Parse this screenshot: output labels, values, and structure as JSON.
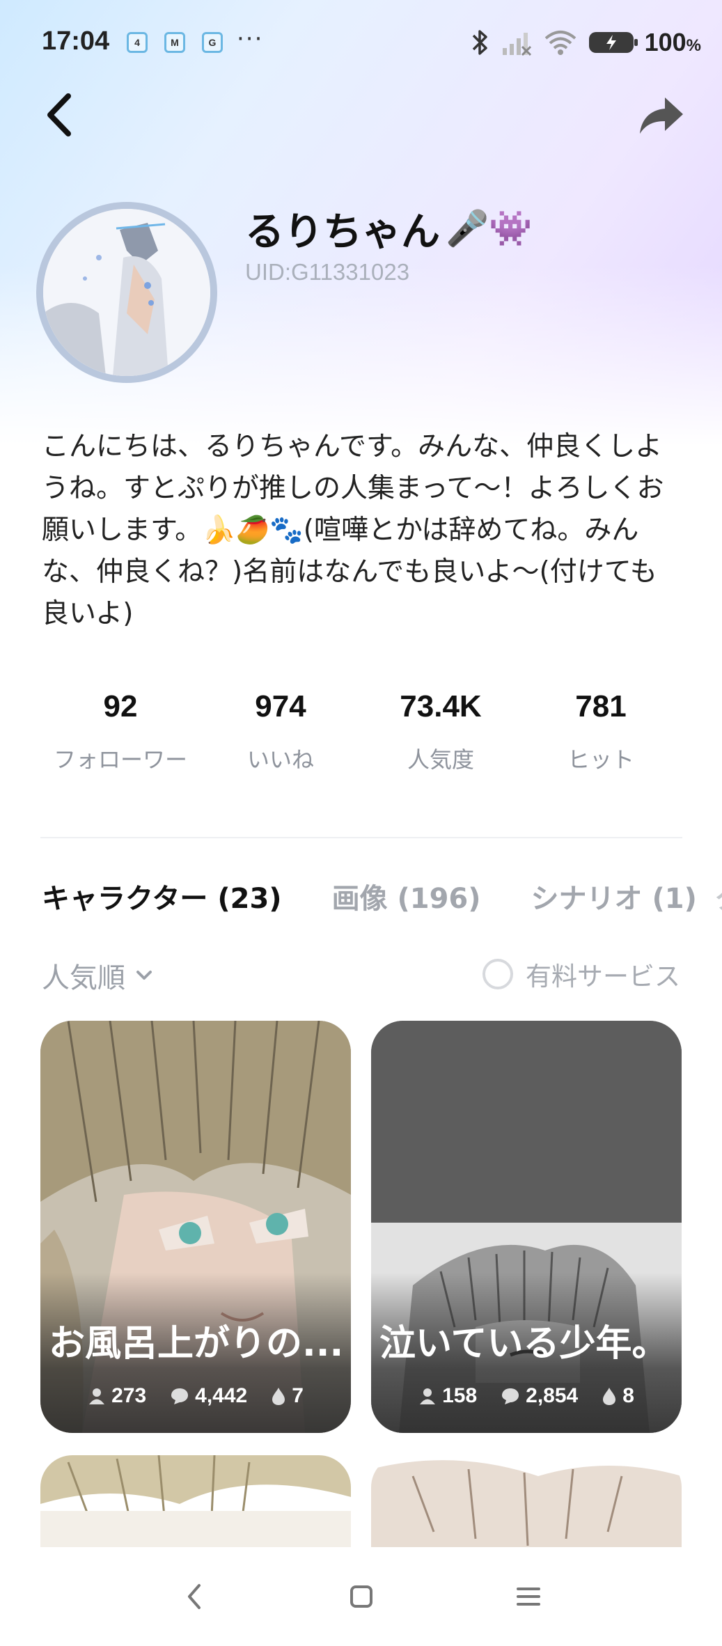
{
  "status_bar": {
    "time": "17:04",
    "notifications": [
      "4",
      "M",
      "G"
    ],
    "more": "···",
    "battery": "100",
    "battery_unit": "%"
  },
  "header": {
    "back_icon": "chevron-left-icon",
    "share_icon": "share-arrow-icon"
  },
  "profile": {
    "name": "るりちゃん",
    "name_emoji": "🎤👾",
    "uid": "UID:G11331023",
    "bio": "こんにちは、るりちゃんです。みんな、仲良くしようね。すとぷりが推しの人集まって〜！よろしくお願いします。🍌🥭🐾(喧嘩とかは辞めてね。みんな、仲良くね？)名前はなんでも良いよ〜(付けても良いよ)"
  },
  "stats": [
    {
      "value": "92",
      "label": "フォローワー"
    },
    {
      "value": "974",
      "label": "いいね"
    },
    {
      "value": "73.4K",
      "label": "人気度"
    },
    {
      "value": "781",
      "label": "ヒット"
    }
  ],
  "tabs": [
    {
      "label": "キャラクター (23)",
      "active": true
    },
    {
      "label": "画像 (196)",
      "active": false
    },
    {
      "label": "シナリオ (1)",
      "active": false
    }
  ],
  "tab_overflow": "ク",
  "filters": {
    "sort_label": "人気順",
    "paid_label": "有料サービス"
  },
  "cards": [
    {
      "title": "お風呂上がりの...",
      "users": "273",
      "chats": "4,442",
      "likes": "7"
    },
    {
      "title": "泣いている少年。",
      "users": "158",
      "chats": "2,854",
      "likes": "8"
    }
  ],
  "colors": {
    "accent_text": "#111111",
    "muted": "#9ba0a8",
    "gradient_start": "#cfeaff",
    "gradient_end": "#e4d6ff"
  }
}
